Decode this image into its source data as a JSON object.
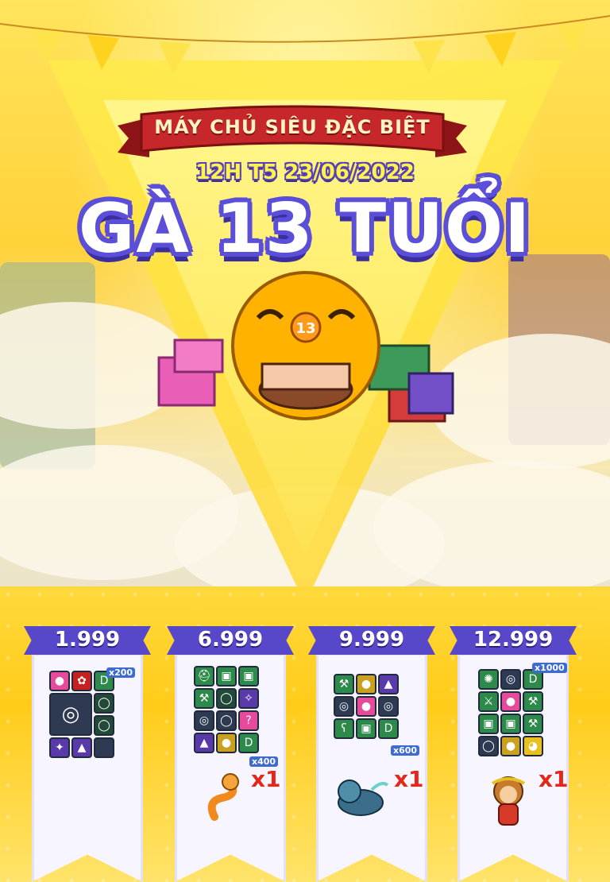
{
  "header": {
    "subtitle": "MÁY CHỦ SIÊU ĐẶC BIỆT",
    "date": "12H T5 23/06/2022",
    "title": "GÀ 13 TUỔI",
    "cake_number": "13"
  },
  "colors": {
    "background": "#ffc21f",
    "title_outline": "#5b4fd9",
    "ribbon": "#c6272a",
    "banner_head": "#5648c9",
    "pet_count": "#e3271d"
  },
  "tiers": [
    {
      "price": "1.999",
      "qty_badge": "x200",
      "pet_count": ""
    },
    {
      "price": "6.999",
      "qty_badge": "x400",
      "pet_count": "x1",
      "pet": "snake-pet-icon"
    },
    {
      "price": "9.999",
      "qty_badge": "x600",
      "pet_count": "x1",
      "pet": "tiger-pet-icon"
    },
    {
      "price": "12.999",
      "qty_badge": "x1000",
      "pet_count": "x1",
      "pet": "monkey-pet-icon"
    }
  ]
}
